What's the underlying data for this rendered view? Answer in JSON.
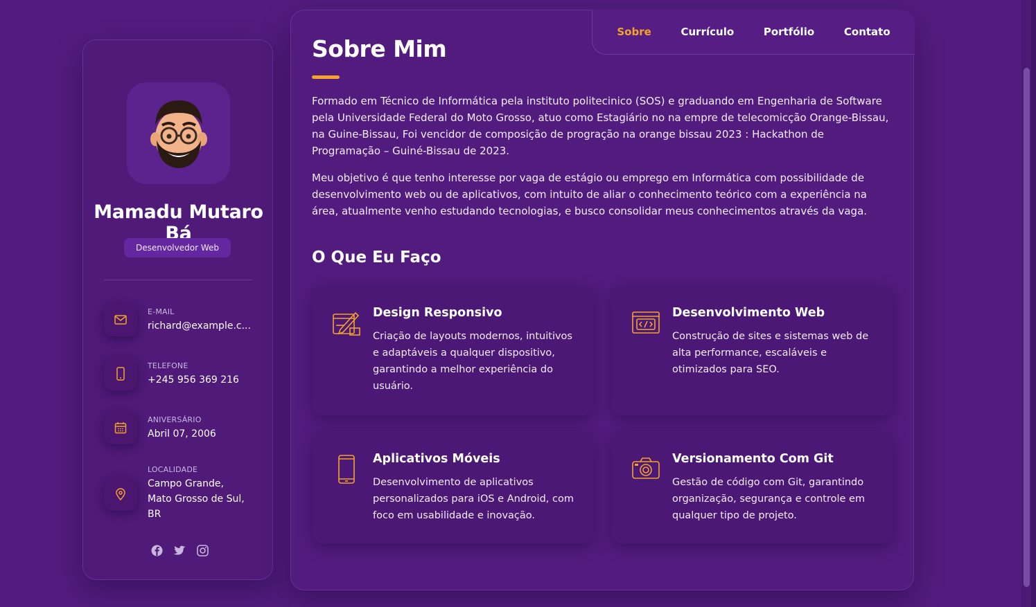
{
  "profile": {
    "name": "Mamadu Mutaro Bá",
    "role": "Desenvolvedor Web",
    "avatar_icon": "memoji-avatar"
  },
  "contacts": [
    {
      "label": "E-MAIL",
      "value": "richard@example.c...",
      "icon": "mail-icon"
    },
    {
      "label": "TELEFONE",
      "value": "+245 956 369 216",
      "icon": "phone-icon"
    },
    {
      "label": "ANIVERSÁRIO",
      "value": "Abril 07, 2006",
      "icon": "calendar-icon"
    },
    {
      "label": "LOCALIDADE",
      "value": "Campo Grande,\nMato Grosso de Sul,\nBR",
      "icon": "location-pin-icon"
    }
  ],
  "social": [
    "facebook-icon",
    "twitter-icon",
    "instagram-icon"
  ],
  "nav": {
    "items": [
      "Sobre",
      "Currículo",
      "Portfólio",
      "Contato"
    ],
    "active": "Sobre"
  },
  "about": {
    "title": "Sobre Mim",
    "paragraphs": [
      "Formado em Técnico de Informática pela instituto politecinico (SOS) e graduando em Engenharia de Software pela Universidade Federal do Moto Grosso, atuo como Estagiário no na empre de telecomicção Orange-Bissau, na Guine-Bissau, Foi vencidor de composição de progração na orange bissau 2023 : Hackathon de Programação – Guiné-Bissau de 2023.",
      "Meu objetivo é que tenho interesse por vaga de estágio ou emprego em Informática com possibilidade de desenvolvimento web ou de aplicativos, com intuito de aliar o conhecimento teórico com a experiência na área, atualmente venho estudando tecnologias, e busco consolidar meus conhecimentos através da vaga."
    ]
  },
  "services": {
    "title": "O Que Eu Faço",
    "items": [
      {
        "title": "Design Responsivo",
        "text": "Criação de layouts modernos, intuitivos e adaptáveis a qualquer dispositivo, garantindo a melhor experiência do usuário.",
        "icon": "design-icon"
      },
      {
        "title": "Desenvolvimento Web",
        "text": "Construção de sites e sistemas web de alta performance, escaláveis e otimizados para SEO.",
        "icon": "code-window-icon"
      },
      {
        "title": "Aplicativos Móveis",
        "text": "Desenvolvimento de aplicativos personalizados para iOS e Android, com foco em usabilidade e inovação.",
        "icon": "smartphone-icon"
      },
      {
        "title": "Versionamento Com Git",
        "text": "Gestão de código com Git, garantindo organização, segurança e controle em qualquer tipo de projeto.",
        "icon": "camera-icon"
      }
    ]
  },
  "colors": {
    "background": "#521c7e",
    "accent": "#f3a32b",
    "card": "#4b1875"
  }
}
